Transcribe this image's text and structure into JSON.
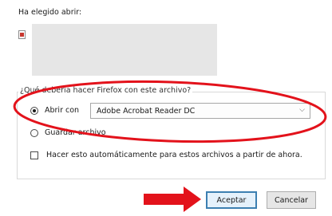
{
  "dialog": {
    "heading": "Ha elegido abrir:"
  },
  "group": {
    "legend": "¿Qué debería hacer Firefox con este archivo?"
  },
  "open_with": {
    "label": "Abrir con",
    "selected": "Adobe Acrobat Reader DC"
  },
  "save_file": {
    "label": "Guardar archivo"
  },
  "remember": {
    "label": "Hacer esto automáticamente para estos archivos a partir de ahora."
  },
  "buttons": {
    "accept": "Aceptar",
    "cancel": "Cancelar"
  },
  "annotations": {
    "ellipse_color": "#e3121b",
    "arrow_color": "#e3121b"
  },
  "icons": {
    "file": "pdf-file-icon",
    "dropdown": "chevron-down-icon"
  }
}
